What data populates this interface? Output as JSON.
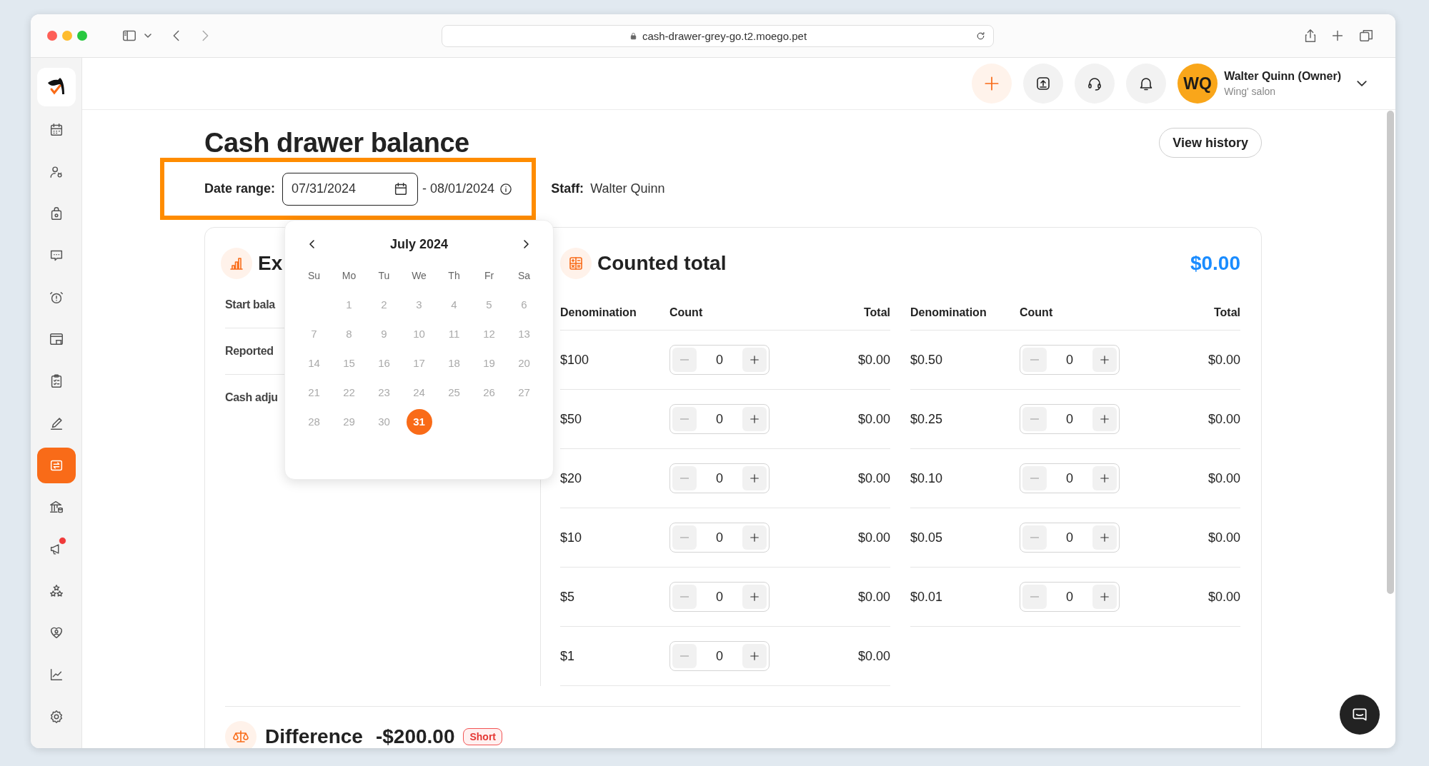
{
  "browser": {
    "url": "cash-drawer-grey-go.t2.moego.pet"
  },
  "sidebar": {
    "items": [
      {
        "kind": "calendar",
        "selected": false,
        "notification": false
      },
      {
        "kind": "people",
        "selected": false,
        "notification": false
      },
      {
        "kind": "bag",
        "selected": false,
        "notification": false
      },
      {
        "kind": "chat",
        "selected": false,
        "notification": false
      },
      {
        "kind": "alarm",
        "selected": false,
        "notification": false
      },
      {
        "kind": "store",
        "selected": false,
        "notification": false
      },
      {
        "kind": "clipboard",
        "selected": false,
        "notification": false
      },
      {
        "kind": "pen",
        "selected": false,
        "notification": false
      },
      {
        "kind": "exchange",
        "selected": true,
        "notification": false
      },
      {
        "kind": "bank",
        "selected": false,
        "notification": false
      },
      {
        "kind": "megaphone",
        "selected": false,
        "notification": true
      },
      {
        "kind": "stars",
        "selected": false,
        "notification": false
      },
      {
        "kind": "heart",
        "selected": false,
        "notification": false
      },
      {
        "kind": "chart",
        "selected": false,
        "notification": false
      },
      {
        "kind": "gear",
        "selected": false,
        "notification": false
      }
    ]
  },
  "header": {
    "user": {
      "initials": "WQ",
      "name": "Walter Quinn (Owner)",
      "business": "Wing' salon"
    }
  },
  "page": {
    "title": "Cash drawer balance",
    "view_history": "View history",
    "date_range": {
      "label": "Date range:",
      "start": "07/31/2024",
      "end": "- 08/01/2024",
      "highlighted": true
    },
    "staff": {
      "label": "Staff:",
      "value": "Walter Quinn"
    }
  },
  "calendar": {
    "month": "July 2024",
    "weekdays": [
      "Su",
      "Mo",
      "Tu",
      "We",
      "Th",
      "Fr",
      "Sa"
    ],
    "weeks": [
      [
        {
          "label": "1",
          "selected": false
        },
        {
          "label": "2",
          "selected": false
        },
        {
          "label": "3",
          "selected": false
        },
        {
          "label": "4",
          "selected": false
        },
        {
          "label": "5",
          "selected": false
        },
        {
          "label": "6",
          "selected": false
        }
      ],
      [
        {
          "label": "7",
          "selected": false
        },
        {
          "label": "8",
          "selected": false
        },
        {
          "label": "9",
          "selected": false
        },
        {
          "label": "10",
          "selected": false
        },
        {
          "label": "11",
          "selected": false
        },
        {
          "label": "12",
          "selected": false
        },
        {
          "label": "13",
          "selected": false
        }
      ],
      [
        {
          "label": "14",
          "selected": false
        },
        {
          "label": "15",
          "selected": false
        },
        {
          "label": "16",
          "selected": false
        },
        {
          "label": "17",
          "selected": false
        },
        {
          "label": "18",
          "selected": false
        },
        {
          "label": "19",
          "selected": false
        },
        {
          "label": "20",
          "selected": false
        }
      ],
      [
        {
          "label": "21",
          "selected": false
        },
        {
          "label": "22",
          "selected": false
        },
        {
          "label": "23",
          "selected": false
        },
        {
          "label": "24",
          "selected": false
        },
        {
          "label": "25",
          "selected": false
        },
        {
          "label": "26",
          "selected": false
        },
        {
          "label": "27",
          "selected": false
        }
      ],
      [
        {
          "label": "28",
          "selected": false
        },
        {
          "label": "29",
          "selected": false
        },
        {
          "label": "30",
          "selected": false
        },
        {
          "label": "31",
          "selected": true
        }
      ]
    ]
  },
  "expected": {
    "title": "Ex",
    "rows": [
      "Start bala",
      "Reported",
      "Cash adju"
    ]
  },
  "counted": {
    "title": "Counted total",
    "total": "$0.00",
    "tables": [
      {
        "columns": [
          "Denomination",
          "Count",
          "Total"
        ],
        "rows": [
          {
            "denomination": "$100",
            "count": "0",
            "total": "$0.00",
            "minus_disabled": true
          },
          {
            "denomination": "$50",
            "count": "0",
            "total": "$0.00",
            "minus_disabled": true
          },
          {
            "denomination": "$20",
            "count": "0",
            "total": "$0.00",
            "minus_disabled": true
          },
          {
            "denomination": "$10",
            "count": "0",
            "total": "$0.00",
            "minus_disabled": true
          },
          {
            "denomination": "$5",
            "count": "0",
            "total": "$0.00",
            "minus_disabled": true
          },
          {
            "denomination": "$1",
            "count": "0",
            "total": "$0.00",
            "minus_disabled": true
          }
        ]
      },
      {
        "columns": [
          "Denomination",
          "Count",
          "Total"
        ],
        "rows": [
          {
            "denomination": "$0.50",
            "count": "0",
            "total": "$0.00",
            "minus_disabled": true
          },
          {
            "denomination": "$0.25",
            "count": "0",
            "total": "$0.00",
            "minus_disabled": true
          },
          {
            "denomination": "$0.10",
            "count": "0",
            "total": "$0.00",
            "minus_disabled": true
          },
          {
            "denomination": "$0.05",
            "count": "0",
            "total": "$0.00",
            "minus_disabled": true
          },
          {
            "denomination": "$0.01",
            "count": "0",
            "total": "$0.00",
            "minus_disabled": true
          }
        ]
      }
    ]
  },
  "difference": {
    "title": "Difference",
    "amount": "-$200.00",
    "tag": "Short"
  }
}
